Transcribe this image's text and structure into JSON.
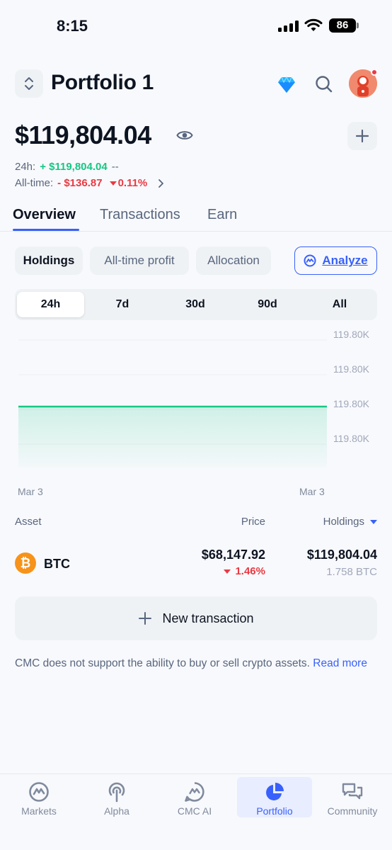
{
  "status": {
    "time": "8:15",
    "battery": "86"
  },
  "header": {
    "title": "Portfolio 1"
  },
  "balance": {
    "total": "$119,804.04",
    "change_24h_label": "24h:",
    "change_24h_value": "+ $119,804.04",
    "change_24h_pct": "--",
    "alltime_label": "All-time:",
    "alltime_value": "- $136.87",
    "alltime_pct": "0.11%"
  },
  "tabs": [
    "Overview",
    "Transactions",
    "Earn"
  ],
  "chips": [
    "Holdings",
    "All-time profit",
    "Allocation"
  ],
  "analyze_label": "Analyze",
  "timeframes": [
    "24h",
    "7d",
    "30d",
    "90d",
    "All"
  ],
  "chart_data": {
    "type": "area",
    "x": [
      "Mar 3",
      "Mar 3"
    ],
    "series": [
      {
        "values": [
          119804.04,
          119804.04
        ]
      }
    ],
    "y_ticks": [
      "119.80K",
      "119.80K",
      "119.80K",
      "119.80K"
    ],
    "x_ticks": [
      "Mar 3",
      "Mar 3"
    ],
    "color": "#16c784",
    "grid": true
  },
  "table": {
    "headers": {
      "asset": "Asset",
      "price": "Price",
      "holdings": "Holdings"
    },
    "rows": [
      {
        "symbol": "BTC",
        "price": "$68,147.92",
        "change": "1.46%",
        "holdings_value": "$119,804.04",
        "holdings_qty": "1.758 BTC"
      }
    ]
  },
  "new_transaction_label": "New transaction",
  "disclaimer": {
    "text": "CMC does not support the ability to buy or sell crypto assets. ",
    "link": "Read more"
  },
  "nav": [
    "Markets",
    "Alpha",
    "CMC AI",
    "Portfolio",
    "Community"
  ],
  "colors": {
    "accent": "#3861fb",
    "up": "#16c784",
    "down": "#ea3943",
    "btc": "#f7931a"
  }
}
